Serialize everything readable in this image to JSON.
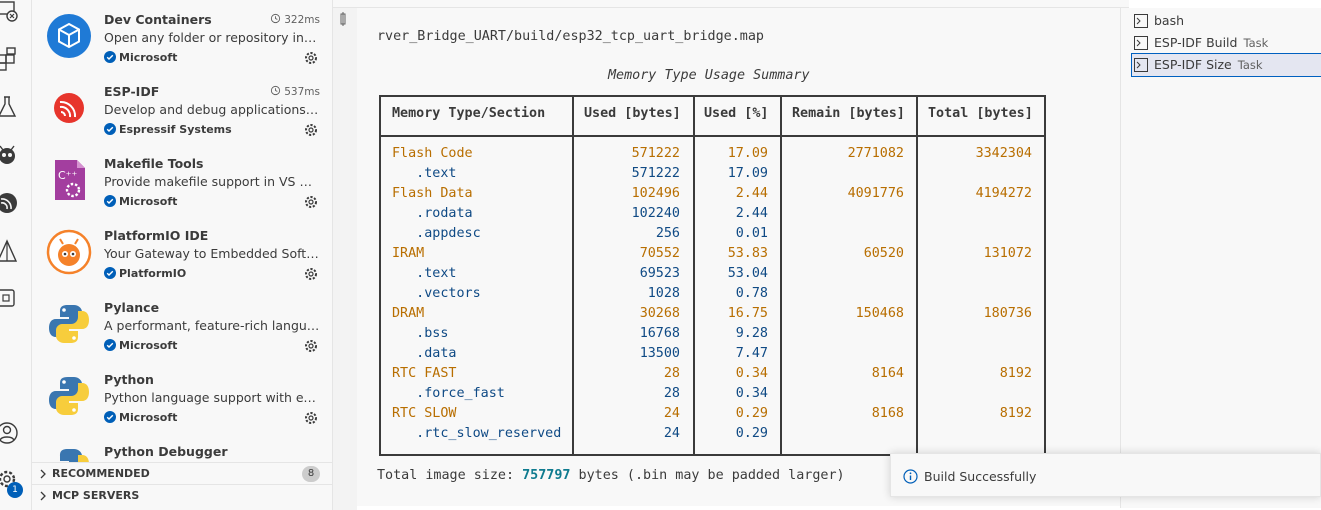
{
  "extensions": [
    {
      "name": "Dev Containers",
      "timer": "322ms",
      "description": "Open any folder or repository insid...",
      "publisher": "Microsoft"
    },
    {
      "name": "ESP-IDF",
      "timer": "537ms",
      "description": "Develop and debug applications for...",
      "publisher": "Espressif Systems"
    },
    {
      "name": "Makefile Tools",
      "timer": "",
      "description": "Provide makefile support in VS Cod...",
      "publisher": "Microsoft"
    },
    {
      "name": "PlatformIO IDE",
      "timer": "",
      "description": "Your Gateway to Embedded Softw...",
      "publisher": "PlatformIO"
    },
    {
      "name": "Pylance",
      "timer": "",
      "description": "A performant, feature-rich languag...",
      "publisher": "Microsoft"
    },
    {
      "name": "Python",
      "timer": "",
      "description": "Python language support with exte...",
      "publisher": "Microsoft"
    },
    {
      "name": "Python Debugger",
      "timer": "",
      "description": "",
      "publisher": ""
    }
  ],
  "sections": {
    "recommended": {
      "label": "RECOMMENDED",
      "count": "8"
    },
    "mcp": {
      "label": "MCP SERVERS"
    }
  },
  "terminal": {
    "path": "rver_Bridge_UART/build/esp32_tcp_uart_bridge.map",
    "summary_title": "Memory Type Usage Summary",
    "headers": [
      "Memory Type/Section",
      "Used [bytes]",
      "Used [%]",
      "Remain [bytes]",
      "Total [bytes]"
    ],
    "rows": [
      {
        "name": "Flash Code",
        "used": "571222",
        "pct": "17.09",
        "remain": "2771082",
        "total": "3342304",
        "kind": "type"
      },
      {
        "name": "   .text",
        "used": "571222",
        "pct": "17.09",
        "remain": "",
        "total": "",
        "kind": "section"
      },
      {
        "name": "Flash Data",
        "used": "102496",
        "pct": "2.44",
        "remain": "4091776",
        "total": "4194272",
        "kind": "type"
      },
      {
        "name": "   .rodata",
        "used": "102240",
        "pct": "2.44",
        "remain": "",
        "total": "",
        "kind": "section"
      },
      {
        "name": "   .appdesc",
        "used": "256",
        "pct": "0.01",
        "remain": "",
        "total": "",
        "kind": "section"
      },
      {
        "name": "IRAM",
        "used": "70552",
        "pct": "53.83",
        "remain": "60520",
        "total": "131072",
        "kind": "type"
      },
      {
        "name": "   .text",
        "used": "69523",
        "pct": "53.04",
        "remain": "",
        "total": "",
        "kind": "section"
      },
      {
        "name": "   .vectors",
        "used": "1028",
        "pct": "0.78",
        "remain": "",
        "total": "",
        "kind": "section"
      },
      {
        "name": "DRAM",
        "used": "30268",
        "pct": "16.75",
        "remain": "150468",
        "total": "180736",
        "kind": "type"
      },
      {
        "name": "   .bss",
        "used": "16768",
        "pct": "9.28",
        "remain": "",
        "total": "",
        "kind": "section"
      },
      {
        "name": "   .data",
        "used": "13500",
        "pct": "7.47",
        "remain": "",
        "total": "",
        "kind": "section"
      },
      {
        "name": "RTC FAST",
        "used": "28",
        "pct": "0.34",
        "remain": "8164",
        "total": "8192",
        "kind": "type"
      },
      {
        "name": "   .force_fast",
        "used": "28",
        "pct": "0.34",
        "remain": "",
        "total": "",
        "kind": "section"
      },
      {
        "name": "RTC SLOW",
        "used": "24",
        "pct": "0.29",
        "remain": "8168",
        "total": "8192",
        "kind": "type"
      },
      {
        "name": "   .rtc_slow_reserved",
        "used": "24",
        "pct": "0.29",
        "remain": "",
        "total": "",
        "kind": "section"
      }
    ],
    "total_prefix": "Total image size: ",
    "total_value": "757797",
    "total_suffix": " bytes (.bin may be padded larger)"
  },
  "terminal_tabs": [
    {
      "label": "bash",
      "task": ""
    },
    {
      "label": "ESP-IDF Build",
      "task": "Task"
    },
    {
      "label": "ESP-IDF Size",
      "task": "Task"
    }
  ],
  "toast": {
    "message": "Build Successfully"
  },
  "account_badge": "1",
  "colors": {
    "accent": "#005fb8",
    "type_row": "#b86e00",
    "section_row": "#0f4a85",
    "total_value": "#0f7b8f"
  }
}
